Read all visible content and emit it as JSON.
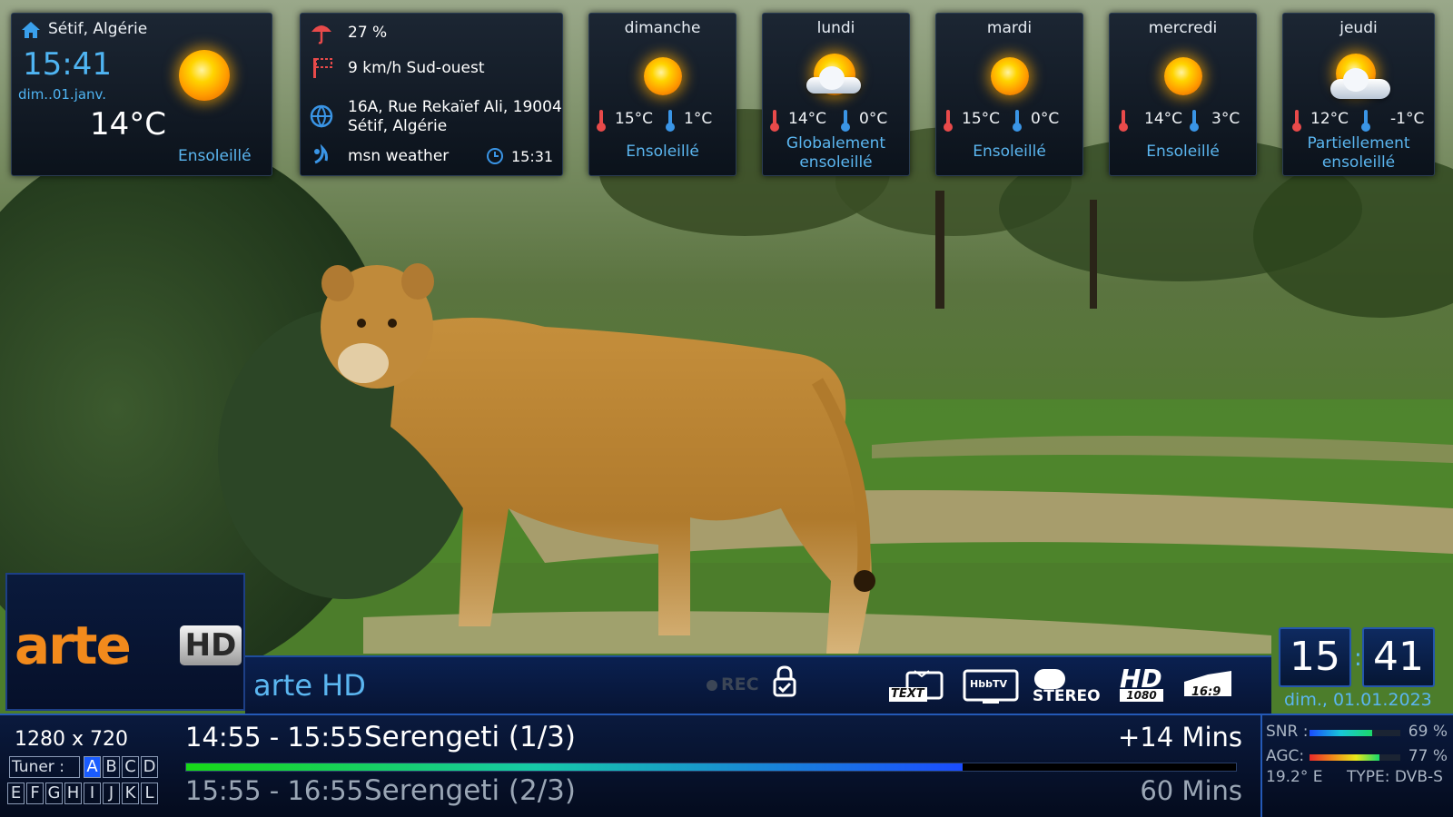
{
  "current": {
    "location": "Sétif, Algérie",
    "time": "15:41",
    "date": "dim..01.janv.",
    "temperature": "14°C",
    "condition": "Ensoleillé"
  },
  "details": {
    "humidity": "27  %",
    "wind": "9 km/h Sud-ouest",
    "address_line1": "16A, Rue Rekaïef Ali, 19004",
    "address_line2": "Sétif, Algérie",
    "provider": "msn  weather",
    "updated": "15:31"
  },
  "forecast": [
    {
      "day": "dimanche",
      "hi": "15°C",
      "lo": "1°C",
      "desc": "Ensoleillé",
      "icon": "sun-icon"
    },
    {
      "day": "lundi",
      "hi": "14°C",
      "lo": "0°C",
      "desc": "Globalement ensoleillé",
      "icon": "mostly-sunny-icon"
    },
    {
      "day": "mardi",
      "hi": "15°C",
      "lo": "0°C",
      "desc": "Ensoleillé",
      "icon": "sun-icon"
    },
    {
      "day": "mercredi",
      "hi": "14°C",
      "lo": "3°C",
      "desc": "Ensoleillé",
      "icon": "sun-icon"
    },
    {
      "day": "jeudi",
      "hi": "12°C",
      "lo": "-1°C",
      "desc": "Partiellement ensoleillé",
      "icon": "partly-cloudy-icon"
    }
  ],
  "channel": {
    "logo_text": "arte",
    "logo_hd": "HD",
    "name": "arte HD",
    "rec_label": "REC",
    "badges": {
      "teletext": "TEXT",
      "hbbtv": "HbbTV",
      "stereo": "STEREO",
      "hd": "HD",
      "hd_res": "1080",
      "aspect": "16:9"
    }
  },
  "clock": {
    "hours": "15",
    "minutes": "41",
    "date": "dim., 01.01.2023"
  },
  "epg": {
    "resolution": "1280 x 720",
    "now_time": "14:55 - 15:55",
    "now_title": "Serengeti (1/3)",
    "now_remaining": "+14 Mins",
    "now_progress": 0.74,
    "next_time": "15:55 - 16:55",
    "next_title": "Serengeti (2/3)",
    "next_duration": "60 Mins"
  },
  "tuner": {
    "label": "Tuner :",
    "row1": [
      "A",
      "B",
      "C",
      "D"
    ],
    "row2": [
      "E",
      "F",
      "G",
      "H",
      "I",
      "J",
      "K",
      "L"
    ],
    "active": "A"
  },
  "signal": {
    "snr_label": "SNR :",
    "snr_value": "69 %",
    "snr_level": 0.69,
    "agc_label": "AGC:",
    "agc_value": "77 %",
    "agc_level": 0.77,
    "orbital": "19.2° E",
    "type": "TYPE: DVB-S"
  },
  "colors": {
    "accent_blue": "#5bb6f0",
    "logo_orange": "#f28a1c",
    "progress_start": "#17d817",
    "progress_end": "#1a4cff"
  }
}
